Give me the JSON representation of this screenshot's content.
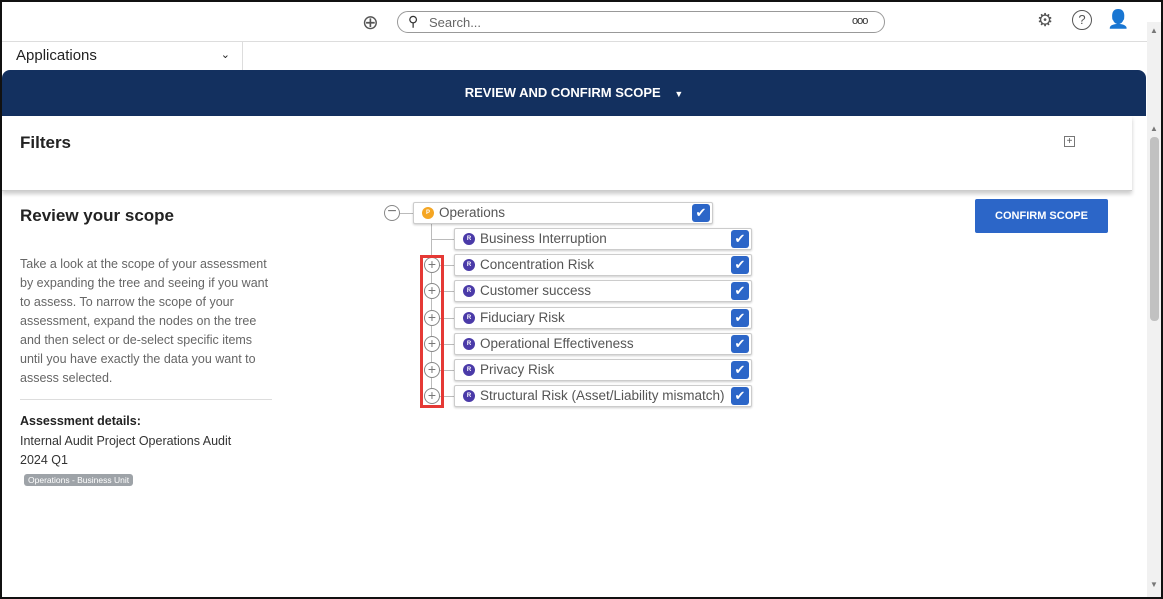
{
  "header": {
    "search_placeholder": "Search...",
    "search_options": "ooo"
  },
  "apps": {
    "label": "Applications"
  },
  "nav": {
    "title": "REVIEW AND CONFIRM SCOPE"
  },
  "filters": {
    "title": "Filters"
  },
  "left": {
    "title": "Review your scope",
    "description": "Take a look at the scope of your assessment by expanding the tree and seeing if you want to assess. To narrow the scope of your assessment, expand the nodes on the tree and then select or de-select specific items until you have exactly the data you want to assess selected.",
    "details_label": "Assessment details:",
    "details_value": "Internal Audit Project Operations Audit 2024 Q1",
    "tag": "Operations - Business Unit"
  },
  "confirm_label": "CONFIRM SCOPE",
  "tree": {
    "root": {
      "label": "Operations",
      "badge": "P",
      "checked": true
    },
    "children": [
      {
        "label": "Business Interruption",
        "badge": "R",
        "checked": true,
        "expandable": false
      },
      {
        "label": "Concentration Risk",
        "badge": "R",
        "checked": true,
        "expandable": true
      },
      {
        "label": "Customer success",
        "badge": "R",
        "checked": true,
        "expandable": true
      },
      {
        "label": "Fiduciary Risk",
        "badge": "R",
        "checked": true,
        "expandable": true
      },
      {
        "label": "Operational Effectiveness",
        "badge": "R",
        "checked": true,
        "expandable": true
      },
      {
        "label": "Privacy Risk",
        "badge": "R",
        "checked": true,
        "expandable": true
      },
      {
        "label": "Structural Risk (Asset/Liability mismatch)",
        "badge": "R",
        "checked": true,
        "expandable": true
      }
    ]
  },
  "colors": {
    "nav": "#13305f",
    "accent": "#2c66c8",
    "highlight": "#e53935"
  }
}
